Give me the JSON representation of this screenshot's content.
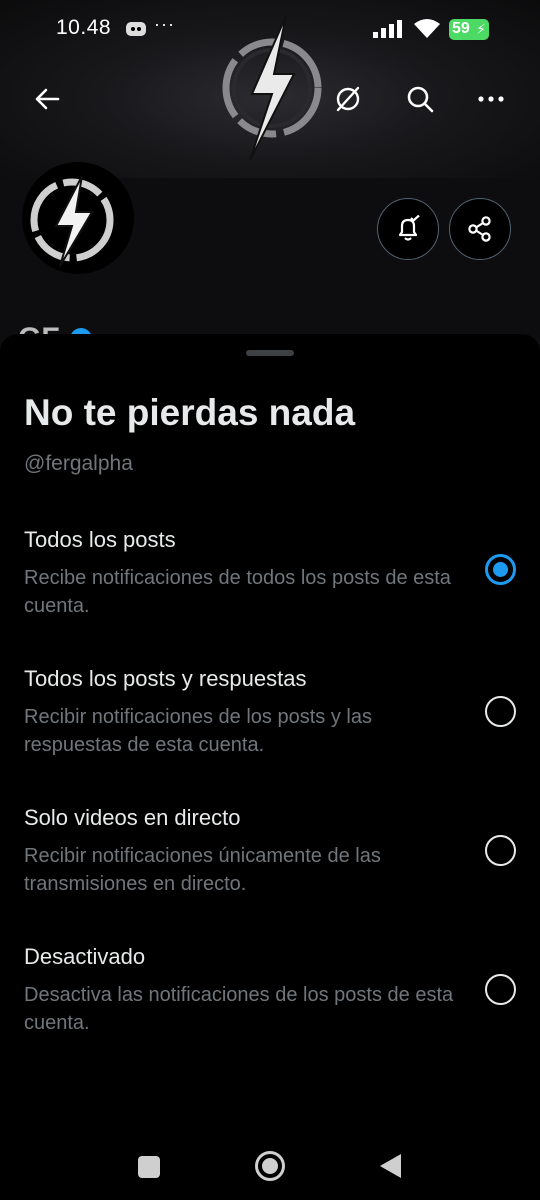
{
  "status_bar": {
    "time": "10.48",
    "more_indicator": "···",
    "battery_level": "59",
    "icons": [
      "app-notification-icon",
      "signal-icon",
      "wifi-icon",
      "battery-charging-icon"
    ]
  },
  "profile_header": {
    "icons": [
      "back-arrow-icon",
      "grok-icon",
      "search-icon",
      "more-dots-icon",
      "bell-check-icon",
      "share-icon"
    ],
    "name_peek": "GF"
  },
  "sheet": {
    "title": "No te pierdas nada",
    "handle": "@fergalpha",
    "options": [
      {
        "label": "Todos los posts",
        "description": "Recibe notificaciones de todos los posts de esta cuenta.",
        "selected": true
      },
      {
        "label": "Todos los posts y respuestas",
        "description": "Recibir notificaciones de los posts y las respuestas de esta cuenta.",
        "selected": false
      },
      {
        "label": "Solo videos en directo",
        "description": "Recibir notificaciones únicamente de las transmisiones en directo.",
        "selected": false
      },
      {
        "label": "Desactivado",
        "description": "Desactiva las notificaciones de los posts de esta cuenta.",
        "selected": false
      }
    ]
  },
  "nav_bar": {
    "icons": [
      "recents-square-icon",
      "home-circle-icon",
      "back-triangle-icon"
    ]
  },
  "colors": {
    "accent": "#1d9bf0",
    "text_primary": "#e7e9ea",
    "text_secondary": "#71767b",
    "background": "#000000",
    "battery": "#4cd964"
  }
}
